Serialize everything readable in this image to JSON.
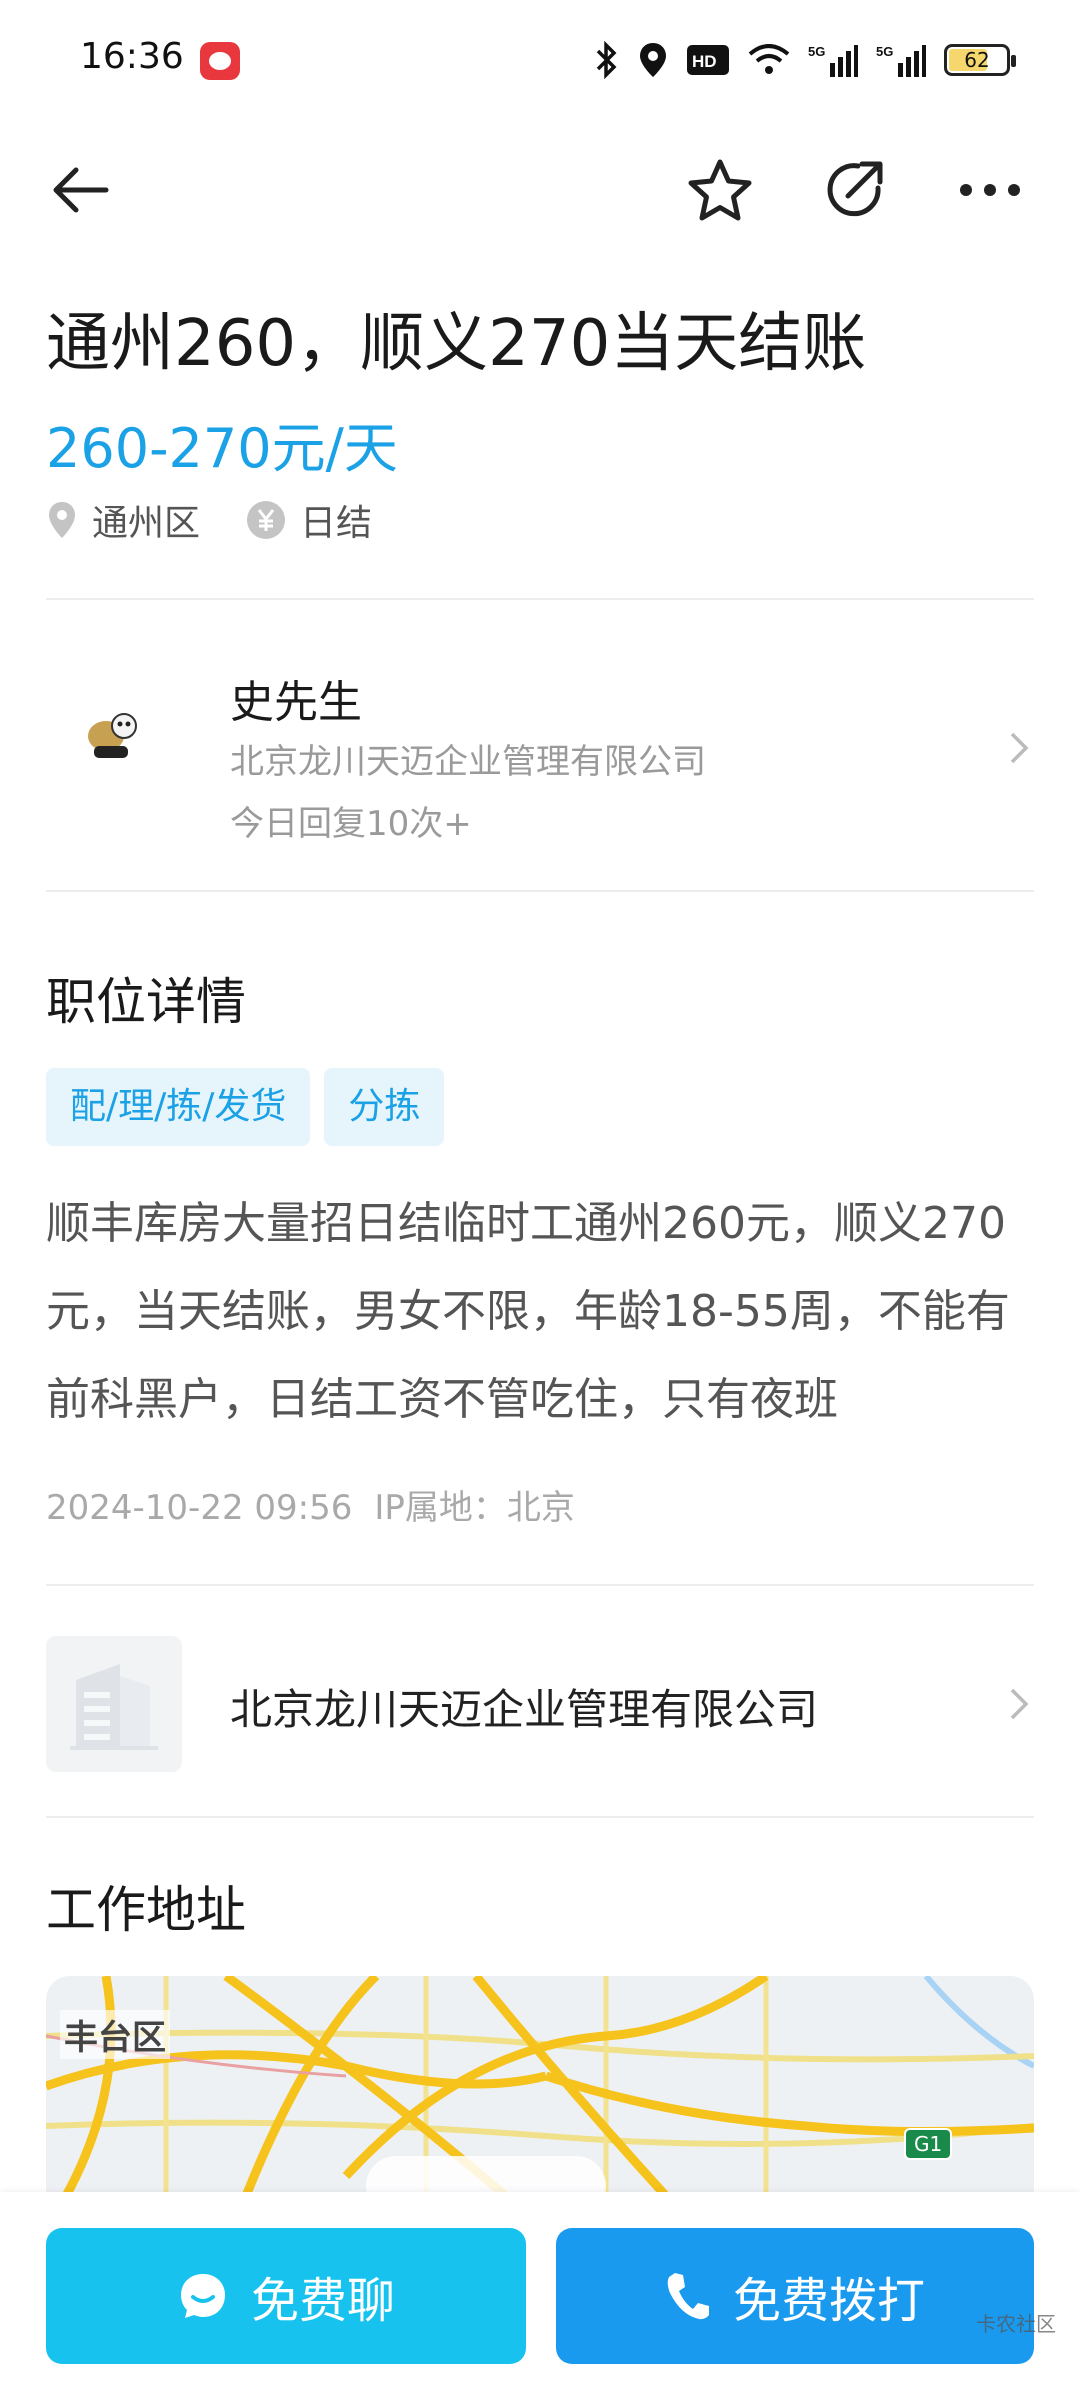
{
  "status_bar": {
    "time": "16:36",
    "battery": "62",
    "icons": [
      "bluetooth-icon",
      "location-icon",
      "hd-icon",
      "wifi-icon",
      "5g-signal-icon",
      "5g-signal-icon",
      "battery-icon"
    ]
  },
  "nav": {
    "back_icon": "arrow-left-icon",
    "favorite_icon": "star-icon",
    "share_icon": "share-icon",
    "more_icon": "more-icon"
  },
  "job": {
    "title": "通州260，顺义270当天结账",
    "salary": "260-270元/天",
    "location": "通州区",
    "settlement": "日结"
  },
  "poster": {
    "name": "史先生",
    "company": "北京龙川天迈企业管理有限公司",
    "reply_info": "今日回复10次+"
  },
  "details": {
    "section_title": "职位详情",
    "tags": [
      "配/理/拣/发货",
      "分拣"
    ],
    "description": "顺丰库房大量招日结临时工通州260元，顺义270元，当天结账，男女不限，年龄18-55周，不能有前科黑户，日结工资不管吃住，只有夜班",
    "posted_time": "2024-10-22 09:56",
    "ip_location": "IP属地：北京"
  },
  "company": {
    "name": "北京龙川天迈企业管理有限公司"
  },
  "work_address": {
    "section_title": "工作地址",
    "map_label": "丰台区",
    "road_badge": "G1"
  },
  "actions": {
    "chat_label": "免费聊",
    "call_label": "免费拨打",
    "watermark": "卡农社区"
  },
  "colors": {
    "accent": "#1aa1e6",
    "chat_button": "#17c3ee",
    "call_button": "#1a9aef"
  }
}
